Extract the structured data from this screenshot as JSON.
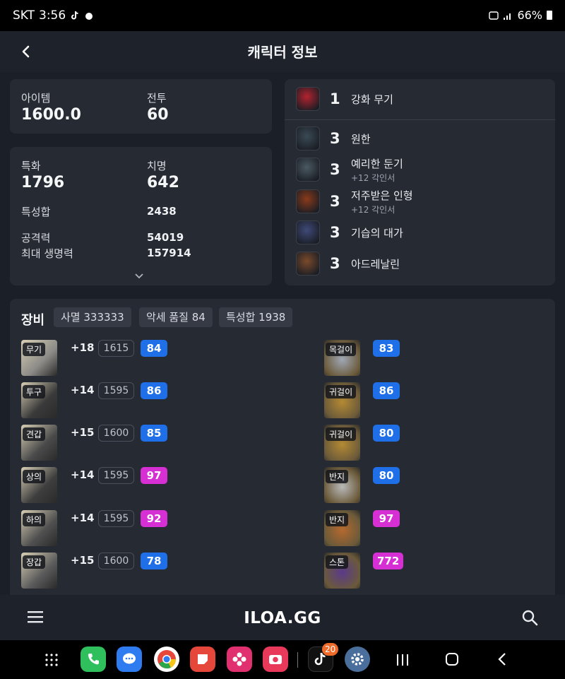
{
  "status_bar": {
    "carrier": "SKT",
    "time": "3:56",
    "battery": "66%"
  },
  "header": {
    "title": "캐릭터 정보"
  },
  "summary": {
    "item_label": "아이템",
    "item_value": "1600.0",
    "combat_label": "전투",
    "combat_value": "60"
  },
  "stats": {
    "spec_label": "특화",
    "spec_value": "1796",
    "crit_label": "치명",
    "crit_value": "642",
    "trait_sum_label": "특성합",
    "trait_sum_value": "2438",
    "attack_label": "공격력",
    "attack_value": "54019",
    "hp_label": "최대 생명력",
    "hp_value": "157914"
  },
  "engravings": [
    {
      "level": "1",
      "name": "강화 무기",
      "sub": "",
      "icon": "weapon-engraving-icon",
      "color": "#b3232f"
    },
    {
      "level": "3",
      "name": "원한",
      "sub": "",
      "icon": "grudge-icon",
      "color": "#3a4a55"
    },
    {
      "level": "3",
      "name": "예리한 둔기",
      "sub": "+12 각인서",
      "icon": "keen-blunt-icon",
      "color": "#4b5a63"
    },
    {
      "level": "3",
      "name": "저주받은 인형",
      "sub": "+12 각인서",
      "icon": "cursed-doll-icon",
      "color": "#8a3a1a"
    },
    {
      "level": "3",
      "name": "기습의 대가",
      "sub": "",
      "icon": "master-ambush-icon",
      "color": "#3f4a78"
    },
    {
      "level": "3",
      "name": "아드레날린",
      "sub": "",
      "icon": "adrenaline-icon",
      "color": "#7a4a2a"
    }
  ],
  "equipment": {
    "title": "장비",
    "chips": [
      "사멸 333333",
      "악세 품질 84",
      "특성합 1938"
    ],
    "left_items": [
      {
        "tag": "무기",
        "plus": "+18",
        "ilvl": "1615",
        "quality": "84",
        "quality_color": "#1e6fe8",
        "icon": "weapon-icon"
      },
      {
        "tag": "투구",
        "plus": "+14",
        "ilvl": "1595",
        "quality": "86",
        "quality_color": "#1e6fe8",
        "icon": "helmet-icon"
      },
      {
        "tag": "견갑",
        "plus": "+15",
        "ilvl": "1600",
        "quality": "85",
        "quality_color": "#1e6fe8",
        "icon": "shoulder-icon"
      },
      {
        "tag": "상의",
        "plus": "+14",
        "ilvl": "1595",
        "quality": "97",
        "quality_color": "#d62fd4",
        "icon": "chest-icon"
      },
      {
        "tag": "하의",
        "plus": "+14",
        "ilvl": "1595",
        "quality": "92",
        "quality_color": "#d62fd4",
        "icon": "pants-icon"
      },
      {
        "tag": "장갑",
        "plus": "+15",
        "ilvl": "1600",
        "quality": "78",
        "quality_color": "#1e6fe8",
        "icon": "gloves-icon"
      }
    ],
    "right_items": [
      {
        "tag": "목걸이",
        "quality": "83",
        "quality_color": "#1e6fe8",
        "icon": "necklace-icon"
      },
      {
        "tag": "귀걸이",
        "quality": "86",
        "quality_color": "#1e6fe8",
        "icon": "earring-icon"
      },
      {
        "tag": "귀걸이",
        "quality": "80",
        "quality_color": "#1e6fe8",
        "icon": "earring-icon"
      },
      {
        "tag": "반지",
        "quality": "80",
        "quality_color": "#1e6fe8",
        "icon": "ring-icon"
      },
      {
        "tag": "반지",
        "quality": "97",
        "quality_color": "#d62fd4",
        "icon": "ring-icon"
      },
      {
        "tag": "스톤",
        "quality": "772",
        "quality_color": "#d62fd4",
        "icon": "stone-icon"
      }
    ]
  },
  "bottom_nav": {
    "brand": "ILOA.GG"
  },
  "android": {
    "tiktok_badge": "20"
  }
}
